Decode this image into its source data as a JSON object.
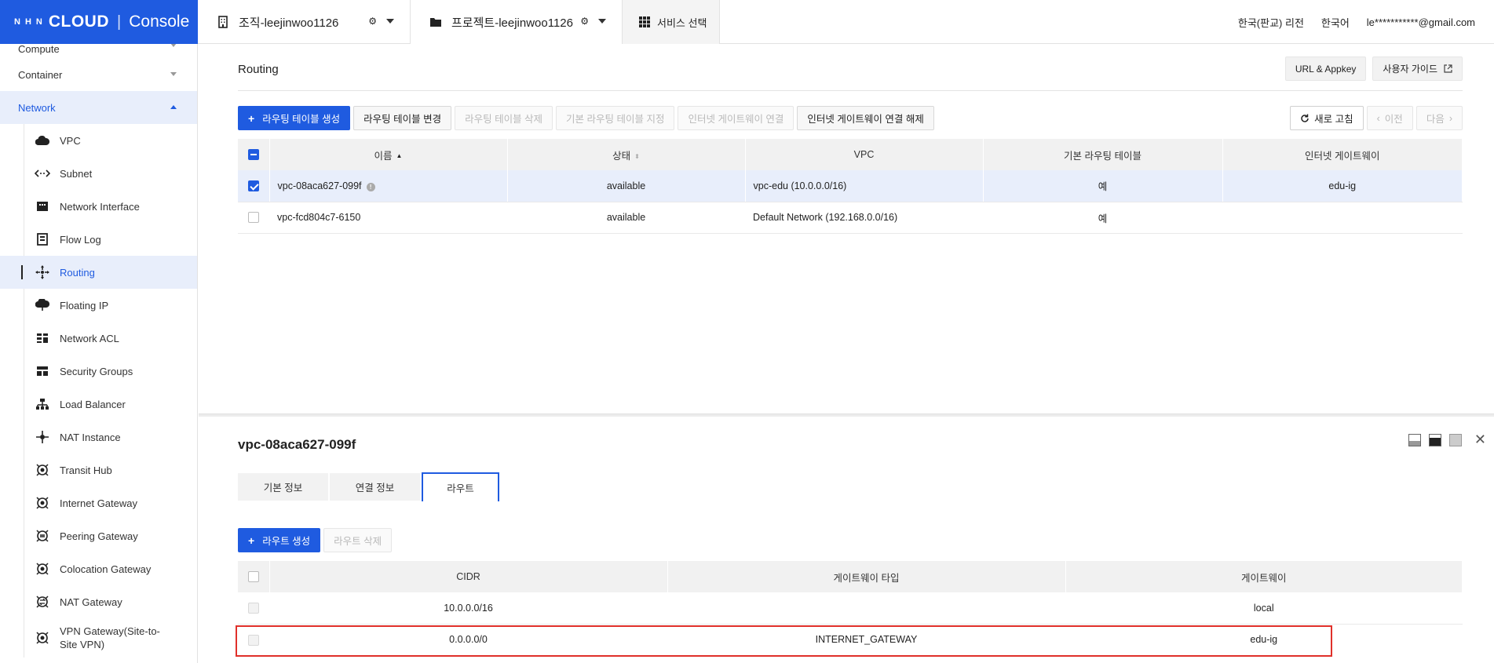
{
  "header": {
    "logo": {
      "brand_small": "NHN",
      "brand": "CLOUD",
      "separator": "|",
      "console": "Console"
    },
    "org": "조직-leejinwoo1126",
    "project": "프로젝트-leejinwoo1126",
    "service_select": "서비스 선택",
    "region": "한국(판교) 리전",
    "language": "한국어",
    "user_email": "le***********@gmail.com"
  },
  "sidebar": {
    "categories": {
      "compute": "Compute",
      "container": "Container",
      "network": "Network"
    },
    "items": [
      {
        "label": "VPC",
        "icon": "cloud-icon"
      },
      {
        "label": "Subnet",
        "icon": "subnet-icon"
      },
      {
        "label": "Network Interface",
        "icon": "network-interface-icon"
      },
      {
        "label": "Flow Log",
        "icon": "flow-log-icon"
      },
      {
        "label": "Routing",
        "icon": "routing-icon",
        "active": true
      },
      {
        "label": "Floating IP",
        "icon": "floating-ip-icon"
      },
      {
        "label": "Network ACL",
        "icon": "network-acl-icon"
      },
      {
        "label": "Security Groups",
        "icon": "security-groups-icon"
      },
      {
        "label": "Load Balancer",
        "icon": "load-balancer-icon"
      },
      {
        "label": "NAT Instance",
        "icon": "nat-instance-icon"
      },
      {
        "label": "Transit Hub",
        "icon": "transit-hub-icon"
      },
      {
        "label": "Internet Gateway",
        "icon": "internet-gateway-icon"
      },
      {
        "label": "Peering Gateway",
        "icon": "peering-gateway-icon"
      },
      {
        "label": "Colocation Gateway",
        "icon": "colocation-gateway-icon"
      },
      {
        "label": "NAT Gateway",
        "icon": "nat-gateway-icon"
      },
      {
        "label": "VPN Gateway(Site-to-Site VPN)",
        "icon": "vpn-gateway-icon"
      }
    ]
  },
  "main": {
    "title": "Routing",
    "url_appkey": "URL & Appkey",
    "user_guide": "사용자 가이드",
    "toolbar": {
      "create": "라우팅 테이블 생성",
      "modify": "라우팅 테이블 변경",
      "delete": "라우팅 테이블 삭제",
      "set_default": "기본 라우팅 테이블 지정",
      "connect_igw": "인터넷 게이트웨이 연결",
      "disconnect_igw": "인터넷 게이트웨이 연결 해제",
      "refresh": "새로 고침",
      "prev": "이전",
      "next": "다음"
    },
    "table": {
      "columns": [
        "이름",
        "상태",
        "VPC",
        "기본 라우팅 테이블",
        "인터넷 게이트웨이"
      ],
      "rows": [
        {
          "name": "vpc-08aca627-099f",
          "status": "available",
          "vpc": "vpc-edu (10.0.0.0/16)",
          "default": "예",
          "igw": "edu-ig",
          "selected": true
        },
        {
          "name": "vpc-fcd804c7-6150",
          "status": "available",
          "vpc": "Default Network (192.168.0.0/16)",
          "default": "예",
          "igw": "",
          "selected": false
        }
      ]
    }
  },
  "detail": {
    "title": "vpc-08aca627-099f",
    "tabs": [
      "기본 정보",
      "연결 정보",
      "라우트"
    ],
    "active_tab": "라우트",
    "create_route": "라우트 생성",
    "delete_route": "라우트 삭제",
    "routes": {
      "columns": [
        "CIDR",
        "게이트웨이 타입",
        "게이트웨이"
      ],
      "rows": [
        {
          "cidr": "10.0.0.0/16",
          "type": "",
          "gateway": "local"
        },
        {
          "cidr": "0.0.0.0/0",
          "type": "INTERNET_GATEWAY",
          "gateway": "edu-ig"
        }
      ]
    }
  },
  "colors": {
    "primary": "#1f5be0",
    "highlight": "#e0302a"
  }
}
